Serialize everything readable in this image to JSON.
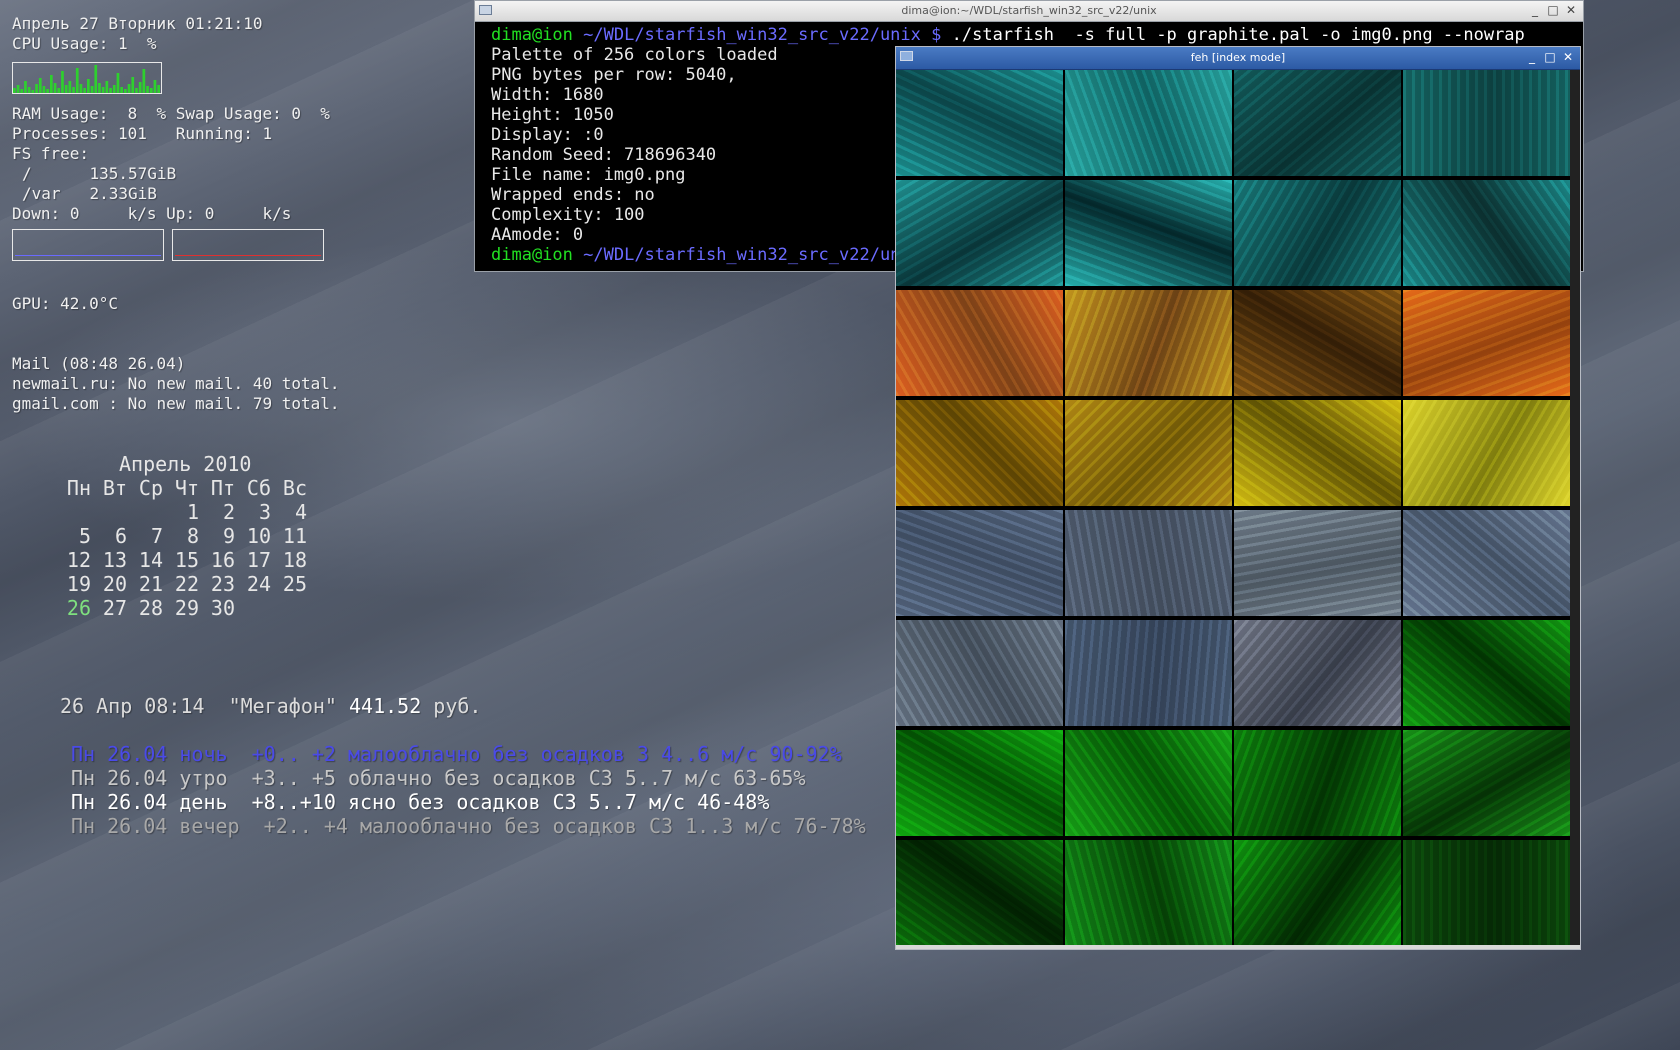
{
  "conky": {
    "datetime": "Апрель 27 Вторник 01:21:10",
    "cpu_label": "CPU Usage:",
    "cpu_value": "1  %",
    "cpu_graph": [
      5,
      8,
      4,
      12,
      6,
      3,
      9,
      15,
      7,
      4,
      18,
      10,
      5,
      22,
      8,
      12,
      6,
      25,
      9,
      5,
      14,
      7,
      28,
      10,
      6,
      12,
      5,
      8,
      20,
      6,
      4,
      9,
      16,
      5,
      11,
      24,
      7,
      5,
      13,
      8
    ],
    "ram_label": "RAM Usage:",
    "ram_value": "8  %",
    "swap_label": "Swap Usage:",
    "swap_value": "0  %",
    "processes_label": "Processes:",
    "processes_value": "101",
    "running_label": "Running:",
    "running_value": "1",
    "fs_label": "FS free:",
    "fs": [
      {
        "mount": "/",
        "free": "135.57GiB"
      },
      {
        "mount": "/var",
        "free": "2.33GiB"
      }
    ],
    "down_label": "Down:",
    "down_value": "0",
    "down_unit": "k/s",
    "up_label": "Up:",
    "up_value": "0",
    "up_unit": "k/s",
    "gpu": "GPU: 42.0°C",
    "mail_header": "Mail (08:48 26.04)",
    "mail_accounts": [
      "newmail.ru: No new mail. 40 total.",
      "gmail.com : No new mail. 79 total."
    ],
    "colors": {
      "down_line": "#6a6aff",
      "up_line": "#e03030",
      "cpu_graph": "#2ed02e"
    }
  },
  "calendar": {
    "title": "Апрель 2010",
    "weekdays": [
      "Пн",
      "Вт",
      "Ср",
      "Чт",
      "Пт",
      "Сб",
      "Вс"
    ],
    "weeks": [
      [
        "",
        "",
        "",
        "1",
        "2",
        "3",
        "4"
      ],
      [
        "5",
        "6",
        "7",
        "8",
        "9",
        "10",
        "11"
      ],
      [
        "12",
        "13",
        "14",
        "15",
        "16",
        "17",
        "18"
      ],
      [
        "19",
        "20",
        "21",
        "22",
        "23",
        "24",
        "25"
      ],
      [
        "26",
        "27",
        "28",
        "29",
        "30",
        "",
        ""
      ]
    ],
    "today": "26",
    "today_color": "#7fe07f"
  },
  "balance": {
    "text": "26 Апр 08:14  \"Мегафон\"",
    "amount": "441.52",
    "currency": "руб."
  },
  "weather": [
    {
      "text": "Пн 26.04 ночь  +0.. +2 малооблачно без осадков З 4..6 м/с 90-92%",
      "color": "#4a4ae8"
    },
    {
      "text": "Пн 26.04 утро  +3.. +5 облачно без осадков СЗ 5..7 м/с 63-65%",
      "color": "#c8c8c8"
    },
    {
      "text": "Пн 26.04 день  +8..+10 ясно без осадков СЗ 5..7 м/с 46-48%",
      "color": "#ffffff"
    },
    {
      "text": "Пн 26.04 вечер  +2.. +4 малооблачно без осадков СЗ 1..3 м/с 76-78%",
      "color": "#a8a8a8"
    }
  ],
  "terminal": {
    "title": "dima@ion:~/WDL/starfish_win32_src_v22/unix",
    "prompt_user": "dima@ion",
    "prompt_path": "~/WDL/starfish_win32_src_v22/unix $",
    "command": "./starfish  -s full -p graphite.pal -o img0.png --nowrap",
    "output": [
      "Palette of 256 colors loaded",
      "PNG bytes per row: 5040,",
      "Width: 1680",
      "Height: 1050",
      "Display: :0",
      "Random Seed: 718696340",
      "File name: img0.png",
      "Wrapped ends: no",
      "Complexity: 100",
      "AAmode: 0"
    ],
    "prompt2_path": "~/WDL/starfish_win32_src_v22/un"
  },
  "feh": {
    "title": "feh [index mode]",
    "thumbnails": [
      {
        "c1": "#1e9a9a",
        "c2": "#0c4c50",
        "ang": "25deg"
      },
      {
        "c1": "#2aa8a4",
        "c2": "#127070",
        "ang": "70deg"
      },
      {
        "c1": "#146464",
        "c2": "#0a3838",
        "ang": "140deg"
      },
      {
        "c1": "#166c6a",
        "c2": "#0e4848",
        "ang": "90deg"
      },
      {
        "c1": "#229c9c",
        "c2": "#0a3c40",
        "ang": "150deg"
      },
      {
        "c1": "#2ab8b6",
        "c2": "#042c30",
        "ang": "20deg"
      },
      {
        "c1": "#1a8484",
        "c2": "#0a3e40",
        "ang": "120deg"
      },
      {
        "c1": "#1e9494",
        "c2": "#0c3434",
        "ang": "55deg"
      },
      {
        "c1": "#e06a24",
        "c2": "#8a4a1a",
        "ang": "60deg"
      },
      {
        "c1": "#c8a020",
        "c2": "#7a4a18",
        "ang": "110deg"
      },
      {
        "c1": "#8a5a14",
        "c2": "#3a2208",
        "ang": "30deg"
      },
      {
        "c1": "#e8781c",
        "c2": "#a04a10",
        "ang": "160deg"
      },
      {
        "c1": "#b8860a",
        "c2": "#6a4e04",
        "ang": "45deg"
      },
      {
        "c1": "#b89416",
        "c2": "#7e6408",
        "ang": "135deg"
      },
      {
        "c1": "#d8c414",
        "c2": "#6a5c04",
        "ang": "35deg"
      },
      {
        "c1": "#e0d830",
        "c2": "#8c8a10",
        "ang": "120deg"
      },
      {
        "c1": "#5a6c86",
        "c2": "#46566e",
        "ang": "20deg"
      },
      {
        "c1": "#566478",
        "c2": "#4a5668",
        "ang": "80deg"
      },
      {
        "c1": "#7a8894",
        "c2": "#56626e",
        "ang": "170deg"
      },
      {
        "c1": "#70829a",
        "c2": "#4c5c72",
        "ang": "40deg"
      },
      {
        "c1": "#6e7c8c",
        "c2": "#4a5664",
        "ang": "60deg"
      },
      {
        "c1": "#4a5e78",
        "c2": "#3a4a62",
        "ang": "95deg"
      },
      {
        "c1": "#7a8090",
        "c2": "#3e4452",
        "ang": "130deg"
      },
      {
        "c1": "#14a414",
        "c2": "#023a02",
        "ang": "40deg"
      },
      {
        "c1": "#12b012",
        "c2": "#045a04",
        "ang": "30deg"
      },
      {
        "c1": "#18a818",
        "c2": "#066006",
        "ang": "55deg"
      },
      {
        "c1": "#0e8a0e",
        "c2": "#033a03",
        "ang": "110deg"
      },
      {
        "c1": "#1a9c1a",
        "c2": "#063806",
        "ang": "150deg"
      },
      {
        "c1": "#0c7a0c",
        "c2": "#022202",
        "ang": "35deg"
      },
      {
        "c1": "#14941a",
        "c2": "#064806",
        "ang": "75deg"
      },
      {
        "c1": "#10a010",
        "c2": "#022a02",
        "ang": "125deg"
      },
      {
        "c1": "#0c4c0c",
        "c2": "#062e06",
        "ang": "90deg"
      }
    ]
  }
}
